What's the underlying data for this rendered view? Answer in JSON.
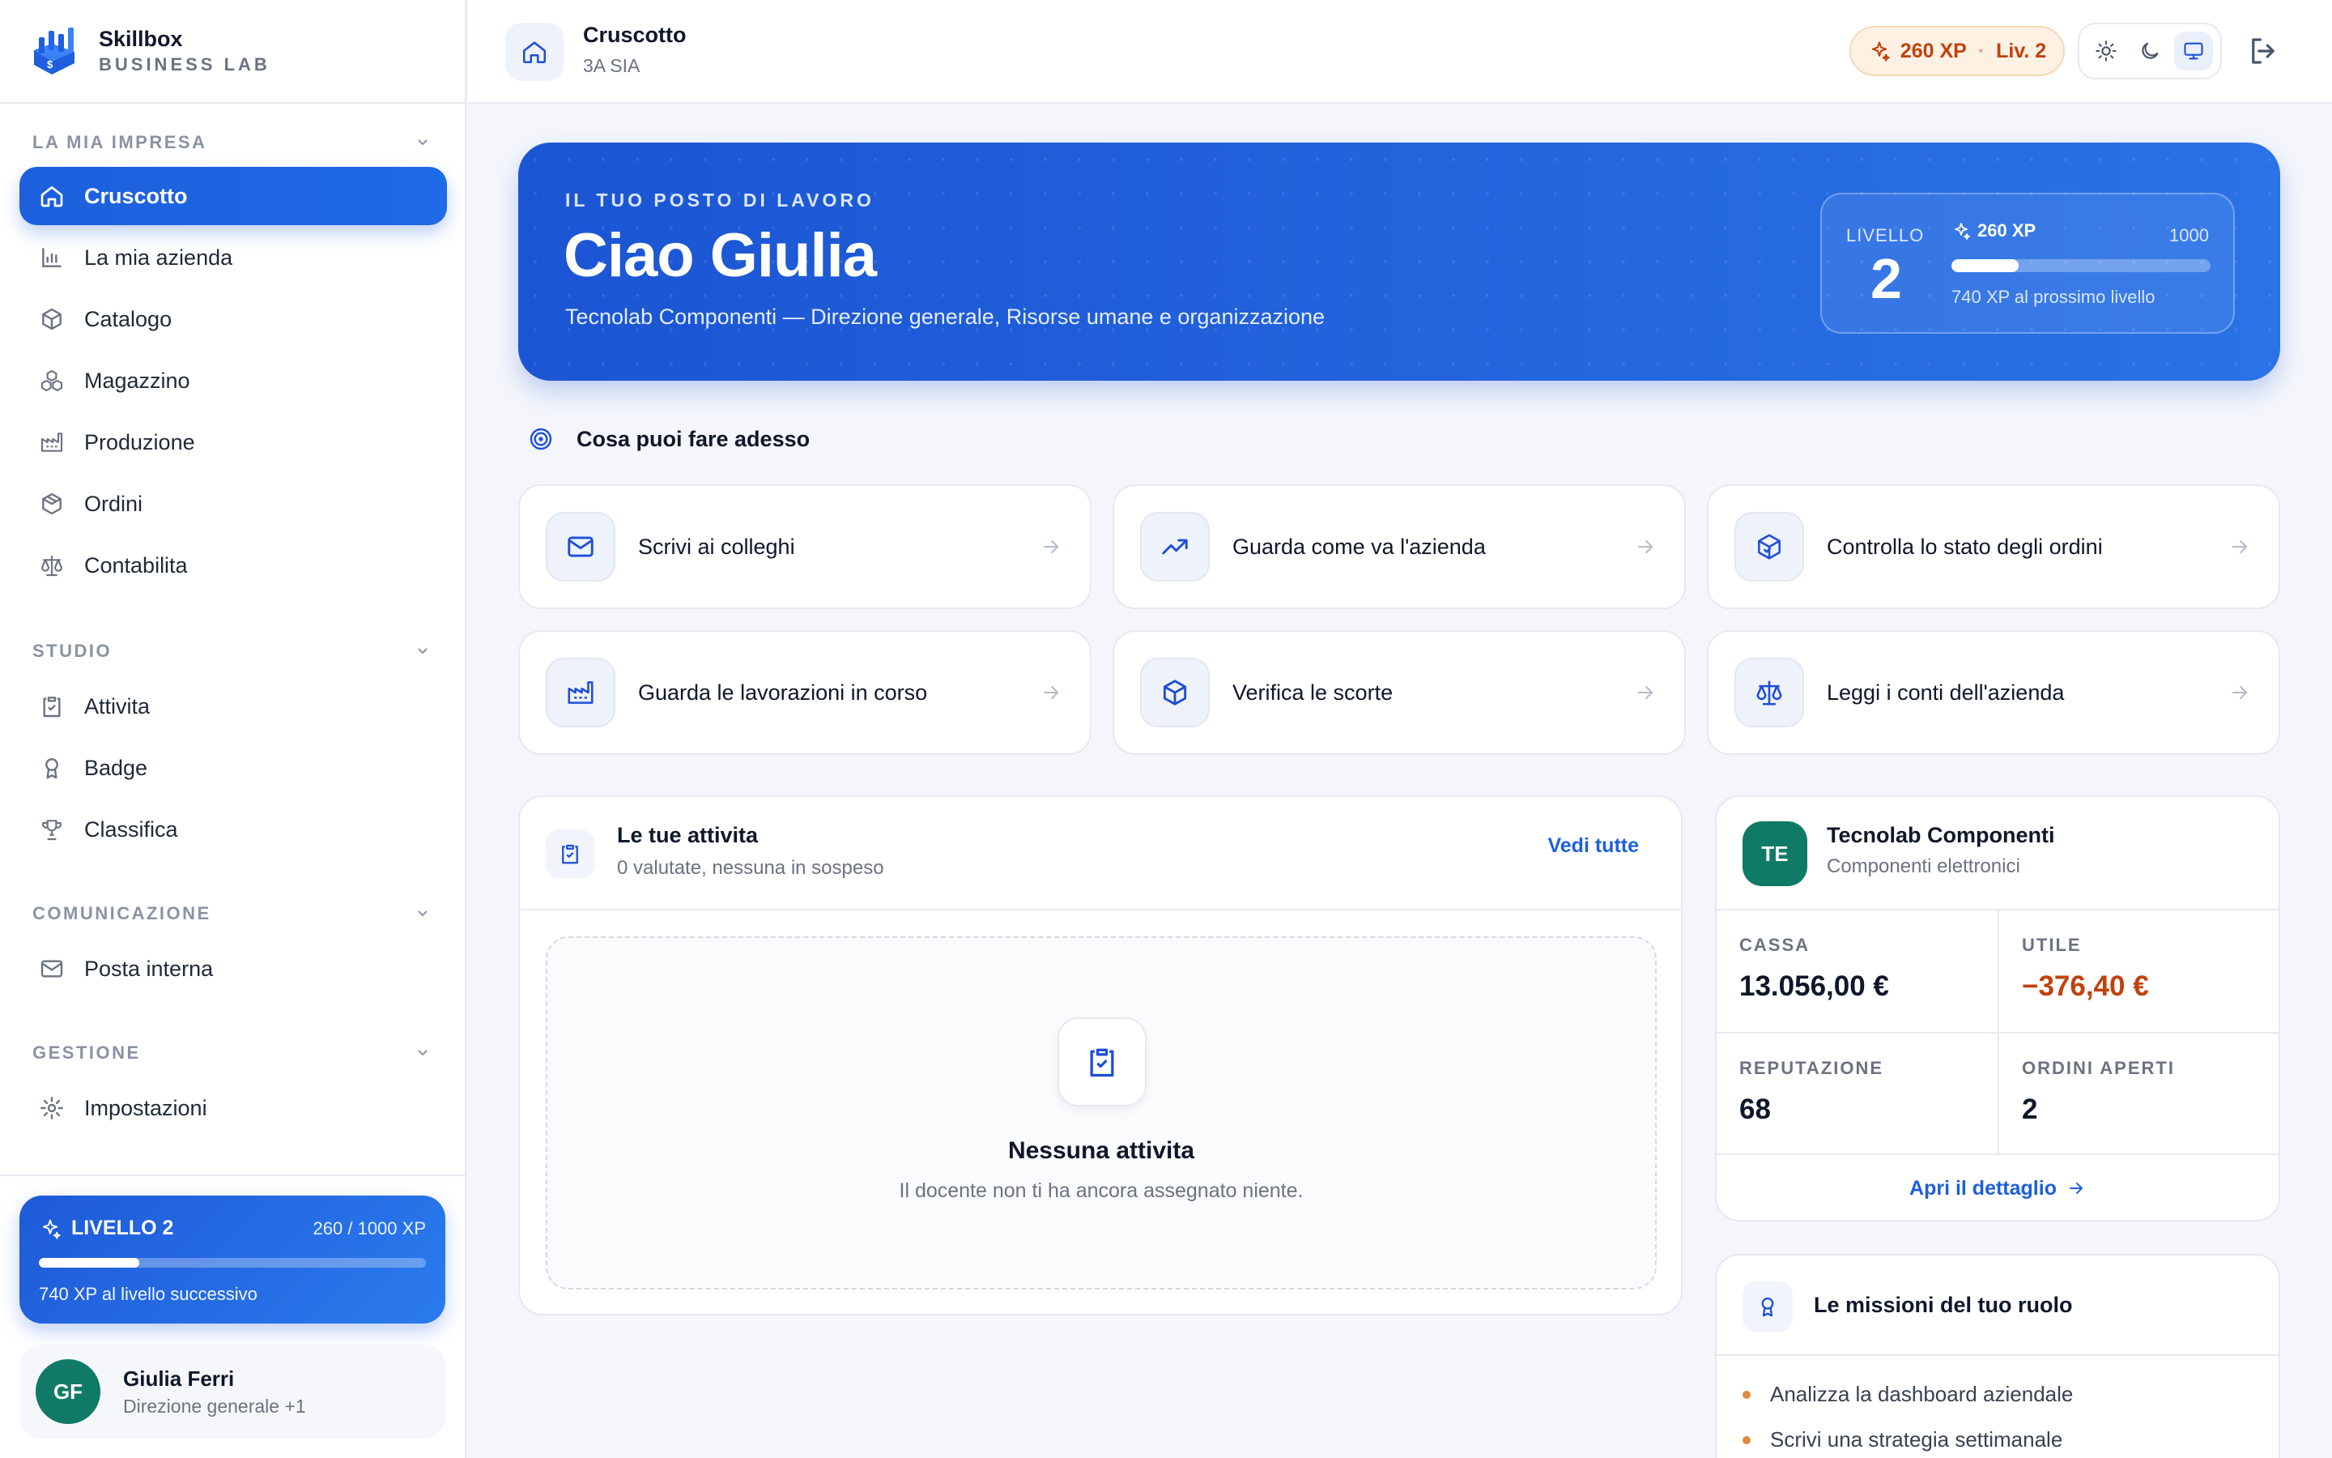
{
  "brand": {
    "name": "Skillbox",
    "sub": "BUSINESS LAB"
  },
  "sidebar": {
    "sections": [
      {
        "title": "LA MIA IMPRESA",
        "items": [
          {
            "label": "Cruscotto",
            "icon": "home-icon",
            "active": true
          },
          {
            "label": "La mia azienda",
            "icon": "bar-chart-icon"
          },
          {
            "label": "Catalogo",
            "icon": "box-icon"
          },
          {
            "label": "Magazzino",
            "icon": "boxes-icon"
          },
          {
            "label": "Produzione",
            "icon": "factory-icon"
          },
          {
            "label": "Ordini",
            "icon": "package-icon"
          },
          {
            "label": "Contabilita",
            "icon": "scale-icon"
          }
        ]
      },
      {
        "title": "STUDIO",
        "items": [
          {
            "label": "Attivita",
            "icon": "clipboard-icon"
          },
          {
            "label": "Badge",
            "icon": "award-icon"
          },
          {
            "label": "Classifica",
            "icon": "trophy-icon"
          }
        ]
      },
      {
        "title": "COMUNICAZIONE",
        "items": [
          {
            "label": "Posta interna",
            "icon": "mail-icon"
          }
        ]
      },
      {
        "title": "GESTIONE",
        "items": [
          {
            "label": "Impostazioni",
            "icon": "gear-icon"
          }
        ]
      }
    ],
    "level_card": {
      "title": "LIVELLO 2",
      "xp": "260 / 1000 XP",
      "progress": 0.26,
      "note": "740 XP al livello successivo"
    },
    "user": {
      "initials": "GF",
      "name": "Giulia Ferri",
      "role": "Direzione generale +1"
    }
  },
  "header": {
    "title": "Cruscotto",
    "subtitle": "3A SIA",
    "xp": "260 XP",
    "level": "Liv. 2"
  },
  "hero": {
    "tag": "IL TUO POSTO DI LAVORO",
    "title": "Ciao Giulia",
    "subtitle": "Tecnolab Componenti — Direzione generale, Risorse umane e organizzazione",
    "level_label": "LIVELLO",
    "level_num": "2",
    "xp": "260 XP",
    "xp_max": "1000",
    "progress": 0.26,
    "note": "740 XP al prossimo livello"
  },
  "actions": {
    "title": "Cosa puoi fare adesso",
    "tiles": [
      {
        "label": "Scrivi ai colleghi",
        "icon": "mail-icon"
      },
      {
        "label": "Guarda come va l'azienda",
        "icon": "trending-up-icon"
      },
      {
        "label": "Controlla lo stato degli ordini",
        "icon": "package-check-icon"
      },
      {
        "label": "Guarda le lavorazioni in corso",
        "icon": "factory-icon"
      },
      {
        "label": "Verifica le scorte",
        "icon": "box-icon"
      },
      {
        "label": "Leggi i conti dell'azienda",
        "icon": "scale-icon"
      }
    ]
  },
  "activities": {
    "title": "Le tue attivita",
    "subtitle": "0 valutate, nessuna in sospeso",
    "link": "Vedi tutte",
    "empty_title": "Nessuna attivita",
    "empty_sub": "Il docente non ti ha ancora assegnato niente."
  },
  "company": {
    "initials": "TE",
    "name": "Tecnolab Componenti",
    "sector": "Componenti elettronici",
    "stats": [
      {
        "key": "CASSA",
        "value": "13.056,00 €"
      },
      {
        "key": "UTILE",
        "value": "−376,40 €",
        "negative": true
      },
      {
        "key": "REPUTAZIONE",
        "value": "68"
      },
      {
        "key": "ORDINI APERTI",
        "value": "2"
      }
    ],
    "link": "Apri il dettaglio"
  },
  "missions": {
    "title": "Le missioni del tuo ruolo",
    "items": [
      "Analizza la dashboard aziendale",
      "Scrivi una strategia settimanale"
    ]
  },
  "colors": {
    "accent": "#1d5fdc",
    "brand_green": "#0f7a66",
    "xp_orange": "#c2410c"
  }
}
